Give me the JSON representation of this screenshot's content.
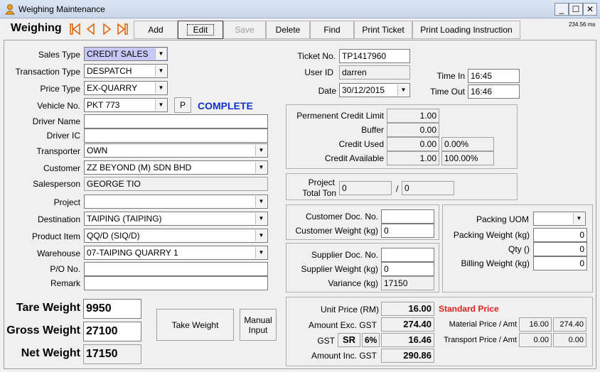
{
  "window": {
    "title": "Weighing Maintenance",
    "min": "_",
    "max": "☐",
    "close": "✕"
  },
  "toolbar": {
    "title": "Weighing",
    "buttons": {
      "add": "Add",
      "edit": "Edit",
      "save": "Save",
      "delete": "Delete",
      "find": "Find",
      "print_ticket": "Print Ticket",
      "print_loading": "Print Loading Instruction"
    },
    "timing": "234.56 ms",
    "nav_color": "#e06000"
  },
  "form": {
    "sales_type": {
      "label": "Sales Type",
      "value": "CREDIT SALES"
    },
    "transaction_type": {
      "label": "Transaction Type",
      "value": "DESPATCH"
    },
    "price_type": {
      "label": "Price Type",
      "value": "EX-QUARRY"
    },
    "vehicle_no": {
      "label": "Vehicle No.",
      "value": "PKT 773",
      "p_button": "P",
      "status": "COMPLETE"
    },
    "driver_name": {
      "label": "Driver Name",
      "value": ""
    },
    "driver_ic": {
      "label": "Driver IC",
      "value": ""
    },
    "transporter": {
      "label": "Transporter",
      "value": "OWN"
    },
    "customer": {
      "label": "Customer",
      "value": "ZZ BEYOND (M) SDN BHD"
    },
    "salesperson": {
      "label": "Salesperson",
      "value": "GEORGE TIO"
    },
    "project": {
      "label": "Project",
      "value": ""
    },
    "destination": {
      "label": "Destination",
      "value": "TAIPING (TAIPING)"
    },
    "product_item": {
      "label": "Product Item",
      "value": "QQ/D (SIQ/D)"
    },
    "warehouse": {
      "label": "Warehouse",
      "value": "07-TAIPING QUARRY 1"
    },
    "po_no": {
      "label": "P/O No.",
      "value": ""
    },
    "remark": {
      "label": "Remark",
      "value": ""
    }
  },
  "ticket": {
    "ticket_no": {
      "label": "Ticket No.",
      "value": "TP1417960"
    },
    "user_id": {
      "label": "User ID",
      "value": "darren"
    },
    "date": {
      "label": "Date",
      "value": "30/12/2015"
    },
    "time_in": {
      "label": "Time In",
      "value": "16:45"
    },
    "time_out": {
      "label": "Time Out",
      "value": "16:46"
    }
  },
  "credit": {
    "limit": {
      "label": "Permenent Credit Limit",
      "value": "1.00"
    },
    "buffer": {
      "label": "Buffer",
      "value": "0.00"
    },
    "used": {
      "label": "Credit Used",
      "value": "0.00",
      "pct": "0.00%"
    },
    "available": {
      "label": "Credit Available",
      "value": "1.00",
      "pct": "100.00%"
    }
  },
  "project_ton": {
    "label1": "Project",
    "label2": "Total Ton",
    "value1": "0",
    "sep": "/",
    "value2": "0"
  },
  "customer_doc": {
    "doc_no": {
      "label": "Customer Doc. No.",
      "value": ""
    },
    "weight": {
      "label": "Customer Weight (kg)",
      "value": "0"
    }
  },
  "supplier_doc": {
    "doc_no": {
      "label": "Supplier Doc. No.",
      "value": ""
    },
    "weight": {
      "label": "Supplier Weight (kg)",
      "value": "0"
    },
    "variance": {
      "label": "Variance (kg)",
      "value": "17150"
    }
  },
  "packing": {
    "uom": {
      "label": "Packing UOM",
      "value": ""
    },
    "weight": {
      "label": "Packing Weight (kg)",
      "value": "0"
    },
    "qty": {
      "label": "Qty ()",
      "value": "0"
    },
    "billing": {
      "label": "Billing Weight (kg)",
      "value": "0"
    }
  },
  "weights": {
    "tare": {
      "label": "Tare Weight",
      "value": "9950"
    },
    "gross": {
      "label": "Gross Weight",
      "value": "27100"
    },
    "net": {
      "label": "Net Weight",
      "value": "17150"
    },
    "take_weight": "Take Weight",
    "manual_input_1": "Manual",
    "manual_input_2": "Input"
  },
  "pricing": {
    "unit_price": {
      "label": "Unit Price (RM)",
      "value": "16.00",
      "tag": "Standard Price"
    },
    "amount_exc": {
      "label": "Amount Exc. GST",
      "value": "274.40"
    },
    "gst": {
      "label": "GST",
      "code": "SR",
      "rate": "6%",
      "value": "16.46"
    },
    "amount_inc": {
      "label": "Amount Inc. GST",
      "value": "290.86"
    },
    "material": {
      "label": "Material Price / Amt",
      "price": "16.00",
      "amt": "274.40"
    },
    "transport": {
      "label": "Transport Price / Amt",
      "price": "0.00",
      "amt": "0.00"
    },
    "tag_color": "#e02020"
  },
  "status_color": "#1030d0"
}
